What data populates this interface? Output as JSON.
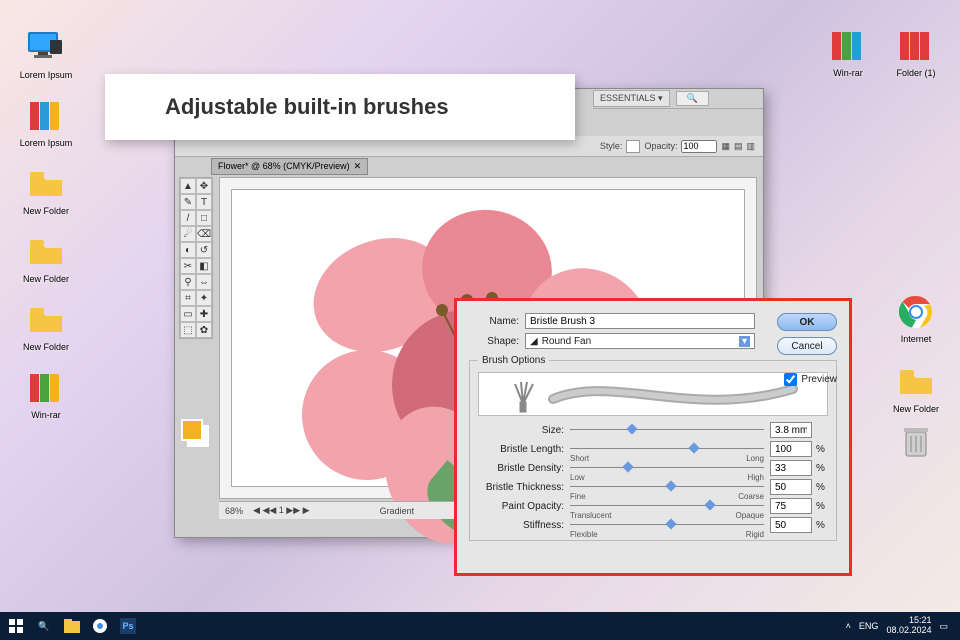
{
  "headline": "Adjustable built-in brushes",
  "desktop": {
    "left": [
      "Lorem Ipsum",
      "Lorem Ipsum",
      "New Folder",
      "New Folder",
      "New Folder",
      "Win-rar"
    ],
    "right_top": [
      "Win-rar",
      "Folder (1)"
    ],
    "right_mid": [
      "Internet",
      "New Folder"
    ]
  },
  "app": {
    "workspace_label": "ESSENTIALS ▾",
    "doc_tab": "Flower* @ 68% (CMYK/Preview)",
    "optbar": {
      "style_lbl": "Style:",
      "opacity_lbl": "Opacity:",
      "opacity_val": "100"
    },
    "status": {
      "zoom": "68%",
      "page": "1",
      "mode": "Gradient"
    },
    "swatches": {
      "fg": "#f5b122",
      "bg": "#ffffff"
    },
    "tool_icons": [
      "▲",
      "✥",
      "✎",
      "T",
      "/",
      "□",
      "☄",
      "⌫",
      "◐",
      "↺",
      "✂",
      "◧",
      "⚲",
      "⇔",
      "⌗",
      "✦",
      "▭",
      "✚",
      "⬚",
      "✿"
    ]
  },
  "dialog": {
    "name_lbl": "Name:",
    "name_val": "Bristle Brush 3",
    "shape_lbl": "Shape:",
    "shape_val": "Round Fan",
    "ok": "OK",
    "cancel": "Cancel",
    "preview_lbl": "Preview",
    "legend": "Brush Options",
    "sliders": [
      {
        "label": "Size:",
        "lo": "",
        "hi": "",
        "val": "3.8 mm",
        "unit": "",
        "pos": 30
      },
      {
        "label": "Bristle Length:",
        "lo": "Short",
        "hi": "Long",
        "val": "100",
        "unit": "%",
        "pos": 62
      },
      {
        "label": "Bristle Density:",
        "lo": "Low",
        "hi": "High",
        "val": "33",
        "unit": "%",
        "pos": 28
      },
      {
        "label": "Bristle Thickness:",
        "lo": "Fine",
        "hi": "Coarse",
        "val": "50",
        "unit": "%",
        "pos": 50
      },
      {
        "label": "Paint Opacity:",
        "lo": "Translucent",
        "hi": "Opaque",
        "val": "75",
        "unit": "%",
        "pos": 70
      },
      {
        "label": "Stiffness:",
        "lo": "Flexible",
        "hi": "Rigid",
        "val": "50",
        "unit": "%",
        "pos": 50
      }
    ]
  },
  "taskbar": {
    "lang": "ENG",
    "time": "15:21",
    "date": "08.02.2024"
  }
}
